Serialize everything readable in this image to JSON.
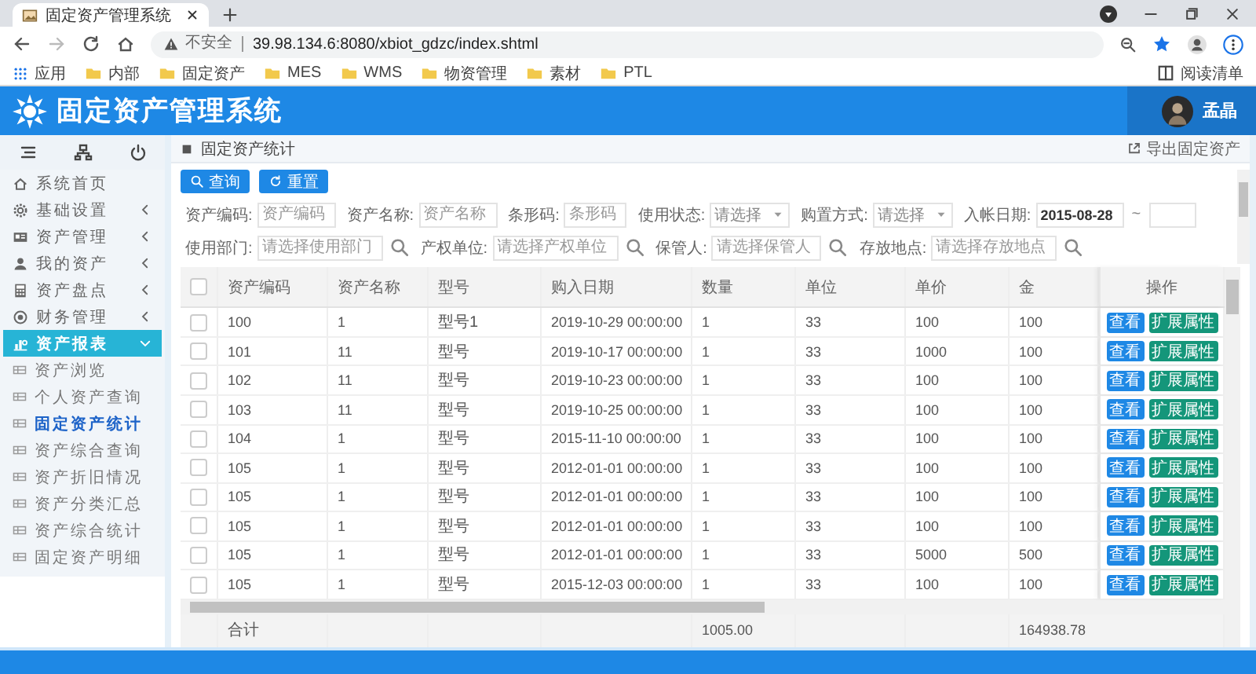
{
  "browser": {
    "tab_title": "固定资产管理系统",
    "security_label": "不安全",
    "url": "39.98.134.6:8080/xbiot_gdzc/index.shtml",
    "bookmarks": [
      {
        "label": "应用",
        "kind": "apps"
      },
      {
        "label": "内部",
        "kind": "folder"
      },
      {
        "label": "固定资产",
        "kind": "folder"
      },
      {
        "label": "MES",
        "kind": "folder"
      },
      {
        "label": "WMS",
        "kind": "folder"
      },
      {
        "label": "物资管理",
        "kind": "folder"
      },
      {
        "label": "素材",
        "kind": "folder"
      },
      {
        "label": "PTL",
        "kind": "folder"
      }
    ],
    "reading_list": "阅读清单"
  },
  "header": {
    "title": "固定资产管理系统",
    "user_name": "孟晶"
  },
  "sidebar": {
    "items": [
      {
        "label": "系统首页",
        "selected": false
      },
      {
        "label": "基础设置",
        "selected": false,
        "expanded": false
      },
      {
        "label": "资产管理",
        "selected": false,
        "expanded": false
      },
      {
        "label": "我的资产",
        "selected": false,
        "expanded": false
      },
      {
        "label": "资产盘点",
        "selected": false,
        "expanded": false
      },
      {
        "label": "财务管理",
        "selected": false,
        "expanded": false
      },
      {
        "label": "资产报表",
        "selected": true,
        "expanded": true,
        "children": [
          {
            "label": "资产浏览",
            "selected": false
          },
          {
            "label": "个人资产查询",
            "selected": false
          },
          {
            "label": "固定资产统计",
            "selected": true
          },
          {
            "label": "资产综合查询",
            "selected": false
          },
          {
            "label": "资产折旧情况",
            "selected": false
          },
          {
            "label": "资产分类汇总",
            "selected": false
          },
          {
            "label": "资产综合统计",
            "selected": false
          },
          {
            "label": "固定资产明细",
            "selected": false
          }
        ]
      }
    ]
  },
  "page": {
    "breadcrumb": "固定资产统计",
    "export_link": "导出固定资产",
    "buttons": [
      {
        "label": "查询",
        "kind": "search"
      },
      {
        "label": "重置",
        "kind": "reset"
      }
    ],
    "filter_rows": [
      [
        {
          "label": "资产编码:",
          "kind": "text",
          "placeholder": "资产编码"
        },
        {
          "label": "资产名称:",
          "kind": "text",
          "placeholder": "资产名称"
        },
        {
          "label": "条形码:",
          "kind": "text",
          "placeholder": "条形码"
        },
        {
          "label": "使用状态:",
          "kind": "select",
          "placeholder": "请选择"
        },
        {
          "label": "购置方式:",
          "kind": "select",
          "placeholder": "请选择"
        },
        {
          "label": "入帐日期:",
          "kind": "date_range",
          "value": "2015-08-28",
          "separator": "~"
        }
      ],
      [
        {
          "label": "使用部门:",
          "kind": "lookup",
          "placeholder": "请选择使用部门"
        },
        {
          "label": "产权单位:",
          "kind": "lookup",
          "placeholder": "请选择产权单位"
        },
        {
          "label": "保管人:",
          "kind": "lookup",
          "placeholder": "请选择保管人"
        },
        {
          "label": "存放地点:",
          "kind": "lookup",
          "placeholder": "请选择存放地点"
        }
      ]
    ]
  },
  "table": {
    "select_all_checked": false,
    "columns": [
      "资产编码",
      "资产名称",
      "型号",
      "购入日期",
      "数量",
      "单位",
      "单价",
      "金",
      "操作"
    ],
    "rows": [
      {
        "checked": false,
        "cells": [
          "100",
          "1",
          "型号1",
          "2019-10-29 00:00:00",
          "1",
          "33",
          "100",
          "100"
        ],
        "actions": [
          {
            "label": "查看",
            "kind": "view"
          },
          {
            "label": "扩展属性",
            "kind": "extend"
          }
        ]
      },
      {
        "checked": false,
        "cells": [
          "101",
          "11",
          "型号",
          "2019-10-17 00:00:00",
          "1",
          "33",
          "1000",
          "100"
        ],
        "actions": [
          {
            "label": "查看",
            "kind": "view"
          },
          {
            "label": "扩展属性",
            "kind": "extend"
          }
        ]
      },
      {
        "checked": false,
        "cells": [
          "102",
          "11",
          "型号",
          "2019-10-23 00:00:00",
          "1",
          "33",
          "100",
          "100"
        ],
        "actions": [
          {
            "label": "查看",
            "kind": "view"
          },
          {
            "label": "扩展属性",
            "kind": "extend"
          }
        ]
      },
      {
        "checked": false,
        "cells": [
          "103",
          "11",
          "型号",
          "2019-10-25 00:00:00",
          "1",
          "33",
          "100",
          "100"
        ],
        "actions": [
          {
            "label": "查看",
            "kind": "view"
          },
          {
            "label": "扩展属性",
            "kind": "extend"
          }
        ]
      },
      {
        "checked": false,
        "cells": [
          "104",
          "1",
          "型号",
          "2015-11-10 00:00:00",
          "1",
          "33",
          "100",
          "100"
        ],
        "actions": [
          {
            "label": "查看",
            "kind": "view"
          },
          {
            "label": "扩展属性",
            "kind": "extend"
          }
        ]
      },
      {
        "checked": false,
        "cells": [
          "105",
          "1",
          "型号",
          "2012-01-01 00:00:00",
          "1",
          "33",
          "100",
          "100"
        ],
        "actions": [
          {
            "label": "查看",
            "kind": "view"
          },
          {
            "label": "扩展属性",
            "kind": "extend"
          }
        ]
      },
      {
        "checked": false,
        "cells": [
          "105",
          "1",
          "型号",
          "2012-01-01 00:00:00",
          "1",
          "33",
          "100",
          "100"
        ],
        "actions": [
          {
            "label": "查看",
            "kind": "view"
          },
          {
            "label": "扩展属性",
            "kind": "extend"
          }
        ]
      },
      {
        "checked": false,
        "cells": [
          "105",
          "1",
          "型号",
          "2012-01-01 00:00:00",
          "1",
          "33",
          "100",
          "100"
        ],
        "actions": [
          {
            "label": "查看",
            "kind": "view"
          },
          {
            "label": "扩展属性",
            "kind": "extend"
          }
        ]
      },
      {
        "checked": false,
        "cells": [
          "105",
          "1",
          "型号",
          "2012-01-01 00:00:00",
          "1",
          "33",
          "5000",
          "500"
        ],
        "actions": [
          {
            "label": "查看",
            "kind": "view"
          },
          {
            "label": "扩展属性",
            "kind": "extend"
          }
        ]
      },
      {
        "checked": false,
        "cells": [
          "105",
          "1",
          "型号",
          "2015-12-03 00:00:00",
          "1",
          "33",
          "100",
          "100"
        ],
        "actions": [
          {
            "label": "查看",
            "kind": "view"
          },
          {
            "label": "扩展属性",
            "kind": "extend"
          }
        ]
      }
    ],
    "totals": {
      "label": "合计",
      "quantity": "1005.00",
      "amount": "164938.78"
    }
  }
}
